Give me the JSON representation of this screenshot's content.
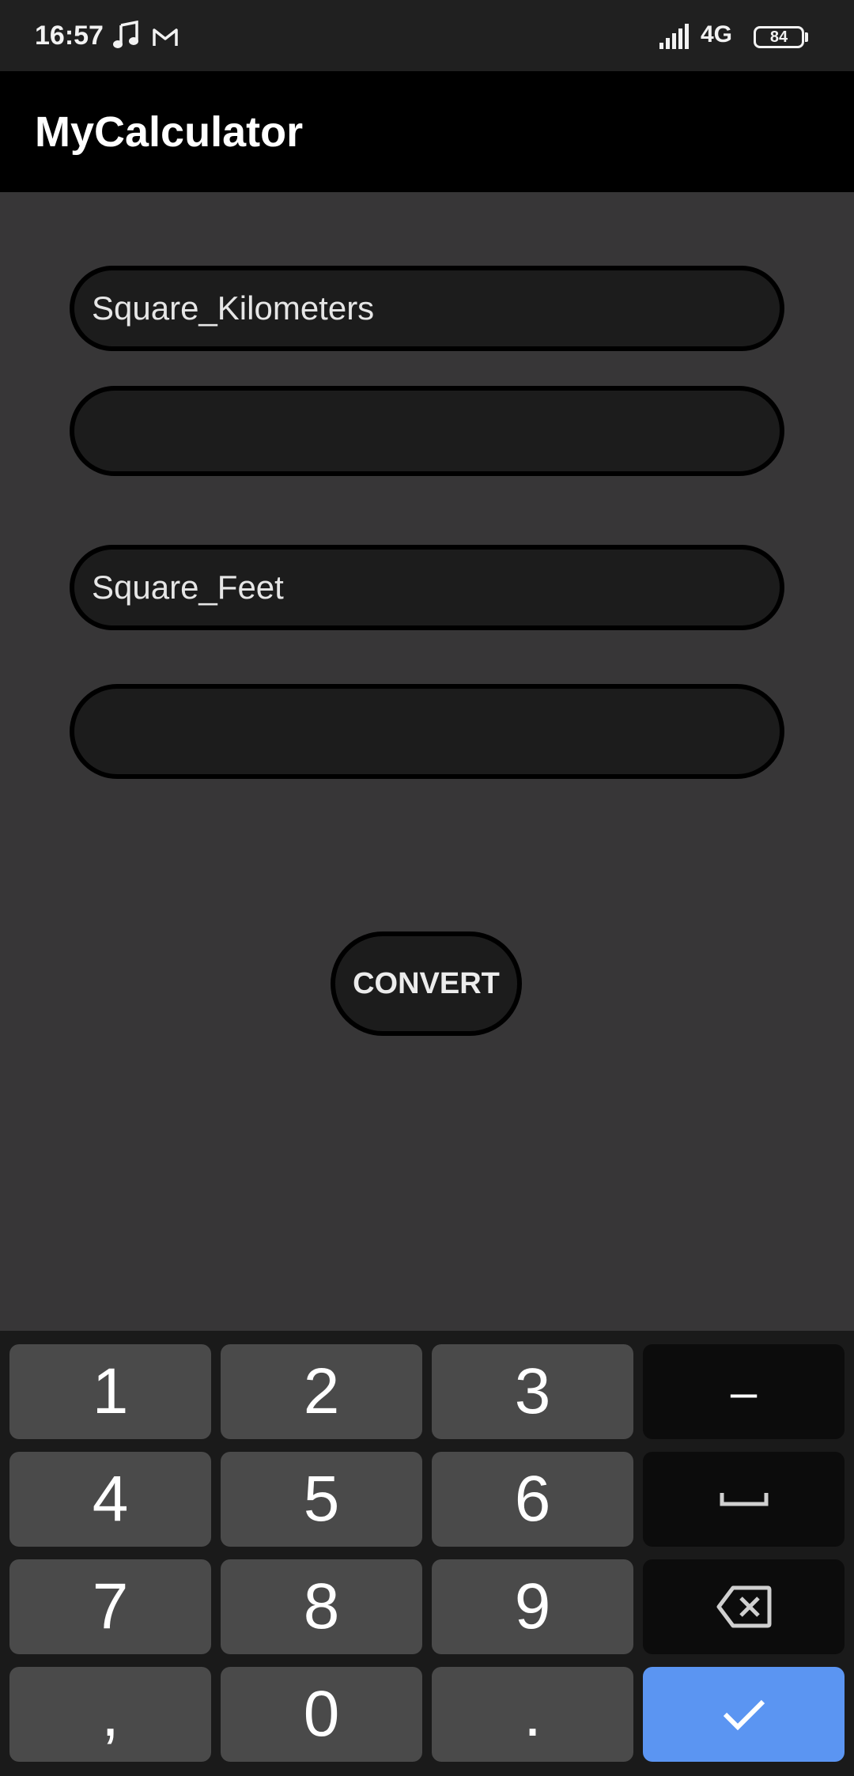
{
  "status_bar": {
    "time": "16:57",
    "network": "4G",
    "battery": "84",
    "icons": [
      "music-note-icon",
      "gmail-icon",
      "signal-icon",
      "battery-icon"
    ]
  },
  "app_bar": {
    "title": "MyCalculator"
  },
  "form": {
    "from_unit": "Square_Kilometers",
    "from_value": "",
    "to_unit": "Square_Feet",
    "to_value": "",
    "convert_label": "CONVERT"
  },
  "keyboard": {
    "rows": [
      [
        "1",
        "2",
        "3",
        "-"
      ],
      [
        "4",
        "5",
        "6",
        "space"
      ],
      [
        "7",
        "8",
        "9",
        "backspace"
      ],
      [
        ",",
        "0",
        ".",
        "done"
      ]
    ],
    "labels": {
      "k1": "1",
      "k2": "2",
      "k3": "3",
      "minus": "–",
      "k4": "4",
      "k5": "5",
      "k6": "6",
      "k7": "7",
      "k8": "8",
      "k9": "9",
      "comma": ",",
      "k0": "0",
      "period": "."
    }
  },
  "colors": {
    "background": "#373637",
    "app_bar": "#000000",
    "status_bar": "#202020",
    "field_fill": "#1c1c1c",
    "key": "#4a4a4a",
    "function_key": "#0c0c0c",
    "enter_key": "#5b95f2"
  }
}
